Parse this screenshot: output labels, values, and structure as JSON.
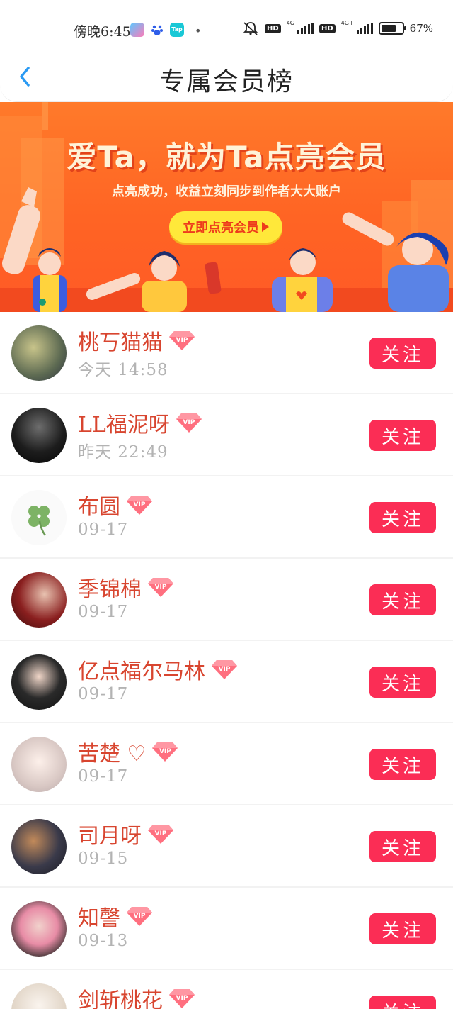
{
  "status_bar": {
    "time": "傍晚6:45",
    "dot": "•",
    "hd1": "HD",
    "net1": "4G",
    "hd2": "HD",
    "net2": "4G+",
    "battery": "67%"
  },
  "header": {
    "title": "专属会员榜"
  },
  "banner": {
    "title": "爱Ta，就为Ta点亮会员",
    "subtitle": "点亮成功，收益立刻同步到作者大大账户",
    "button_label": "立即点亮会员"
  },
  "members": [
    {
      "name": "桃丂猫猫",
      "time": "今天 14:58",
      "badge": "VIP",
      "follow_label": "关注"
    },
    {
      "name": "LL福泥呀",
      "time": "昨天 22:49",
      "badge": "VIP",
      "follow_label": "关注"
    },
    {
      "name": "布圆",
      "time": "09-17",
      "badge": "VIP",
      "follow_label": "关注"
    },
    {
      "name": "季锦棉",
      "time": "09-17",
      "badge": "VIP",
      "follow_label": "关注"
    },
    {
      "name": "亿点福尔马林",
      "time": "09-17",
      "badge": "VIP",
      "follow_label": "关注"
    },
    {
      "name": "苦楚 ♡",
      "time": "09-17",
      "badge": "VIP",
      "follow_label": "关注"
    },
    {
      "name": "司月呀",
      "time": "09-15",
      "badge": "VIP",
      "follow_label": "关注"
    },
    {
      "name": "知謦",
      "time": "09-13",
      "badge": "VIP",
      "follow_label": "关注"
    },
    {
      "name": "剑斩桃花",
      "time": "",
      "badge": "VIP",
      "follow_label": "关注"
    }
  ],
  "colors": {
    "accent_red": "#fb2d55",
    "name_red": "#d8452f",
    "banner_orange": "#ff6424",
    "banner_button": "#ffe83a",
    "back_blue": "#2a9af3"
  },
  "icons": {
    "back": "chevron-left-icon",
    "vip": "diamond-vip-icon",
    "mute": "bell-slash-icon"
  }
}
